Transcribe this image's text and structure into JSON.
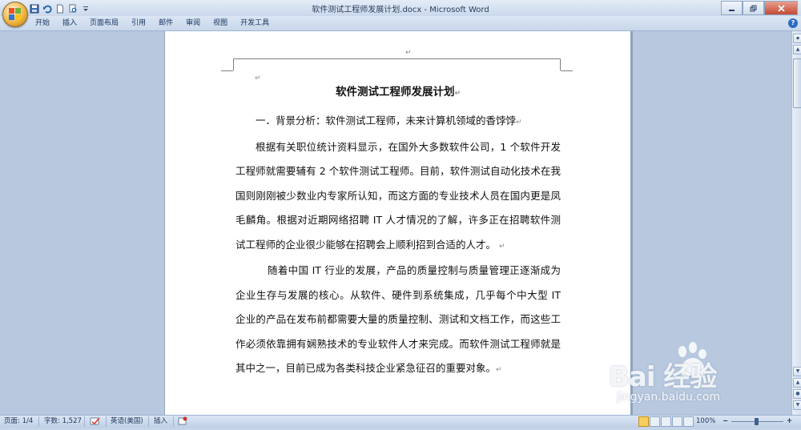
{
  "app": {
    "title": "软件测试工程师发展计划.docx - Microsoft Word",
    "colors": {
      "ribbon": "#c8d7ea",
      "workspace": "#b7c8df",
      "accent": "#2b6cc4"
    }
  },
  "quick_access": [
    {
      "name": "save-icon"
    },
    {
      "name": "undo-icon"
    },
    {
      "name": "new-document-icon"
    },
    {
      "name": "print-preview-icon"
    },
    {
      "name": "customize-dropdown-icon"
    }
  ],
  "ribbon": {
    "tabs": [
      "开始",
      "插入",
      "页面布局",
      "引用",
      "邮件",
      "审阅",
      "视图",
      "开发工具"
    ],
    "help_label": "?"
  },
  "document": {
    "title": "软件测试工程师发展计划",
    "heading1": "一．背景分析：软件测试工程师，未来计算机领域的香饽饽",
    "paragraph1": "根据有关职位统计资料显示，在国外大多数软件公司，1 个软件开发工程师就需要辅有 2 个软件测试工程师。目前，软件测试自动化技术在我国则刚刚被少数业内专家所认知，而这方面的专业技术人员在国内更是凤毛麟角。根据对近期网络招聘 IT 人才情况的了解，许多正在招聘软件测试工程师的企业很少能够在招聘会上顺利招到合适的人才。",
    "paragraph2": "随着中国 IT 行业的发展，产品的质量控制与质量管理正逐渐成为企业生存与发展的核心。从软件、硬件到系统集成，几乎每个中大型 IT 企业的产品在发布前都需要大量的质量控制、测试和文档工作，而这些工作必须依靠拥有娴熟技术的专业软件人才来完成。而软件测试工程师就是其中之一，目前已成为各类科技企业紧急征召的重要对象。",
    "paragraph_mark": "↵"
  },
  "status": {
    "page": "页面: 1/4",
    "words": "字数: 1,527",
    "language": "英语(美国)",
    "mode": "插入",
    "zoom": "100%",
    "zoom_minus": "−",
    "zoom_plus": "+"
  },
  "watermark": {
    "brand": "Bai  经验",
    "url": "jingyan.baidu.com"
  }
}
